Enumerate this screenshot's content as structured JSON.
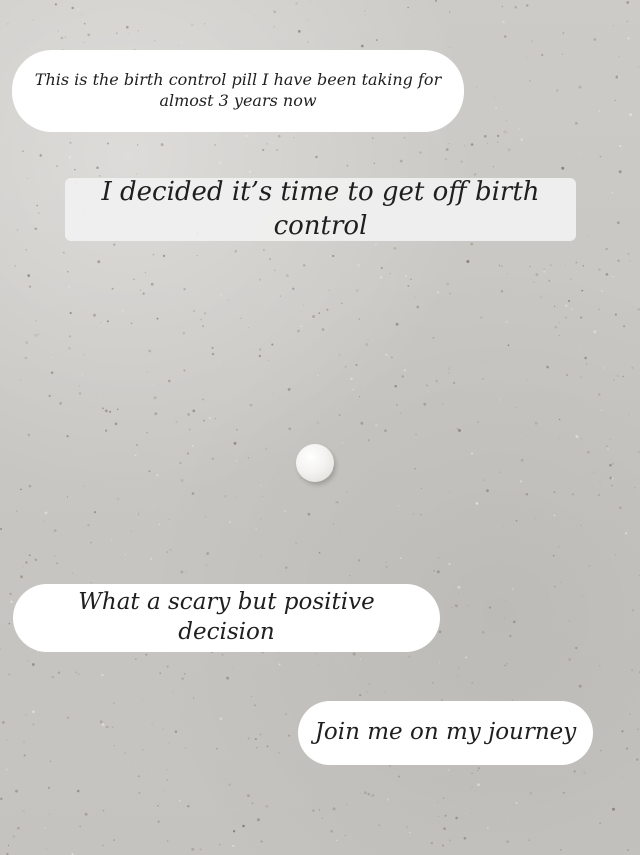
{
  "captions": {
    "first": {
      "line1": "This is the birth control pill I have been taking for",
      "line2": "almost 3 years now"
    },
    "second": "I decided it’s time to get off birth control",
    "third": "What a scary but positive decision",
    "fourth": "Join me on my journey"
  },
  "colors": {
    "background": "#c8c6c2",
    "bubble": "#ffffff",
    "text": "#1f1f1f"
  }
}
